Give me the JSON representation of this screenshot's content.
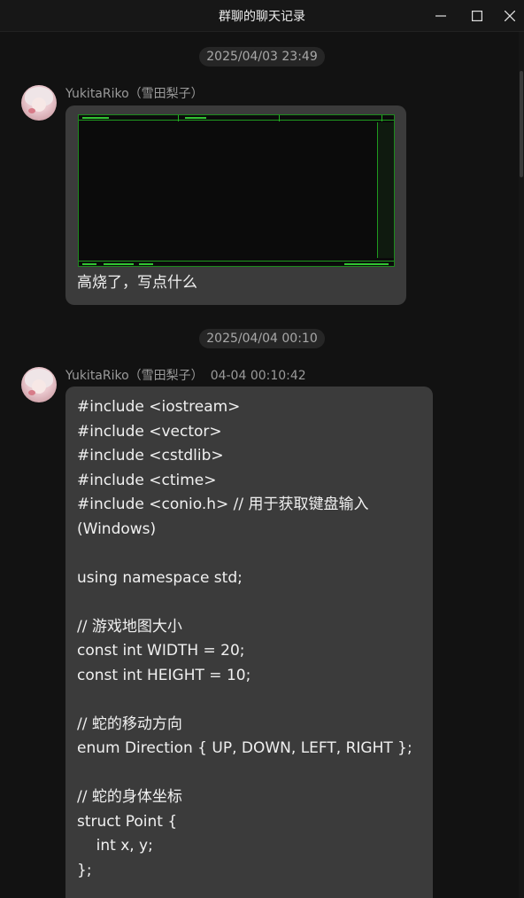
{
  "window": {
    "title": "群聊的聊天记录",
    "controls": {
      "minimize": "—",
      "maximize": "☐",
      "close": "✕"
    }
  },
  "messages": [
    {
      "time_separator": "2025/04/03 23:49",
      "sender": "YukitaRiko（雪田梨子）",
      "timestamp": "",
      "image": "screenshot",
      "text": "高烧了，写点什么"
    },
    {
      "time_separator": "2025/04/04 00:10",
      "sender": "YukitaRiko（雪田梨子）",
      "timestamp": "04-04 00:10:42",
      "code_lines": [
        "#include <iostream>",
        "#include <vector>",
        "#include <cstdlib>",
        "#include <ctime>",
        "#include <conio.h> // 用于获取键盘输入",
        "(Windows)",
        "",
        "using namespace std;",
        "",
        "// 游戏地图大小",
        "const int WIDTH = 20;",
        "const int HEIGHT = 10;",
        "",
        "// 蛇的移动方向",
        "enum Direction { UP, DOWN, LEFT, RIGHT };",
        "",
        "// 蛇的身体坐标",
        "struct Point {",
        "    int x, y;",
        "};"
      ]
    }
  ],
  "icons": {
    "avatar": "avatar-image"
  }
}
